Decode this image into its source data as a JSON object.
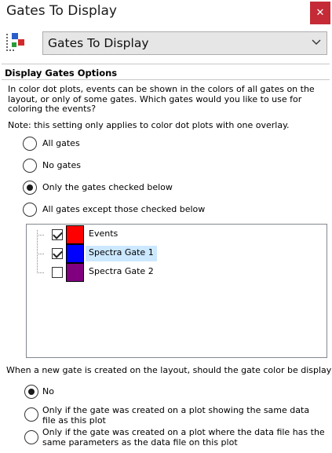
{
  "window": {
    "title": "Gates To Display",
    "close_glyph": "✕"
  },
  "selector": {
    "icon": "gate-overlay-icon",
    "value": "Gates To Display"
  },
  "section": {
    "title": "Display Gates Options",
    "description": "In color dot plots, events can be shown in the colors of all gates on the layout, or only of some gates. Which gates would you like to use for coloring the events?",
    "note": "Note: this setting only applies to color dot plots with one overlay."
  },
  "gate_mode": {
    "selected_index": 2,
    "options": [
      {
        "label": "All gates"
      },
      {
        "label": "No gates"
      },
      {
        "label": "Only the gates checked below"
      },
      {
        "label": "All gates except those checked below"
      }
    ]
  },
  "gates": [
    {
      "label": "Events",
      "checked": true,
      "color": "#ff0000",
      "selected": false
    },
    {
      "label": "Spectra Gate 1",
      "checked": true,
      "color": "#0000ff",
      "selected": true
    },
    {
      "label": "Spectra Gate 2",
      "checked": false,
      "color": "#800080",
      "selected": false
    }
  ],
  "new_gate": {
    "question": "When a new gate is created on the layout, should the gate color be displayed?",
    "selected_index": 0,
    "options": [
      {
        "label": "No"
      },
      {
        "label": "Only if the gate was created on a plot showing the same data file as this plot"
      },
      {
        "label": "Only if the gate was created on a plot where the data file has the same parameters as the data file on this plot"
      }
    ]
  }
}
